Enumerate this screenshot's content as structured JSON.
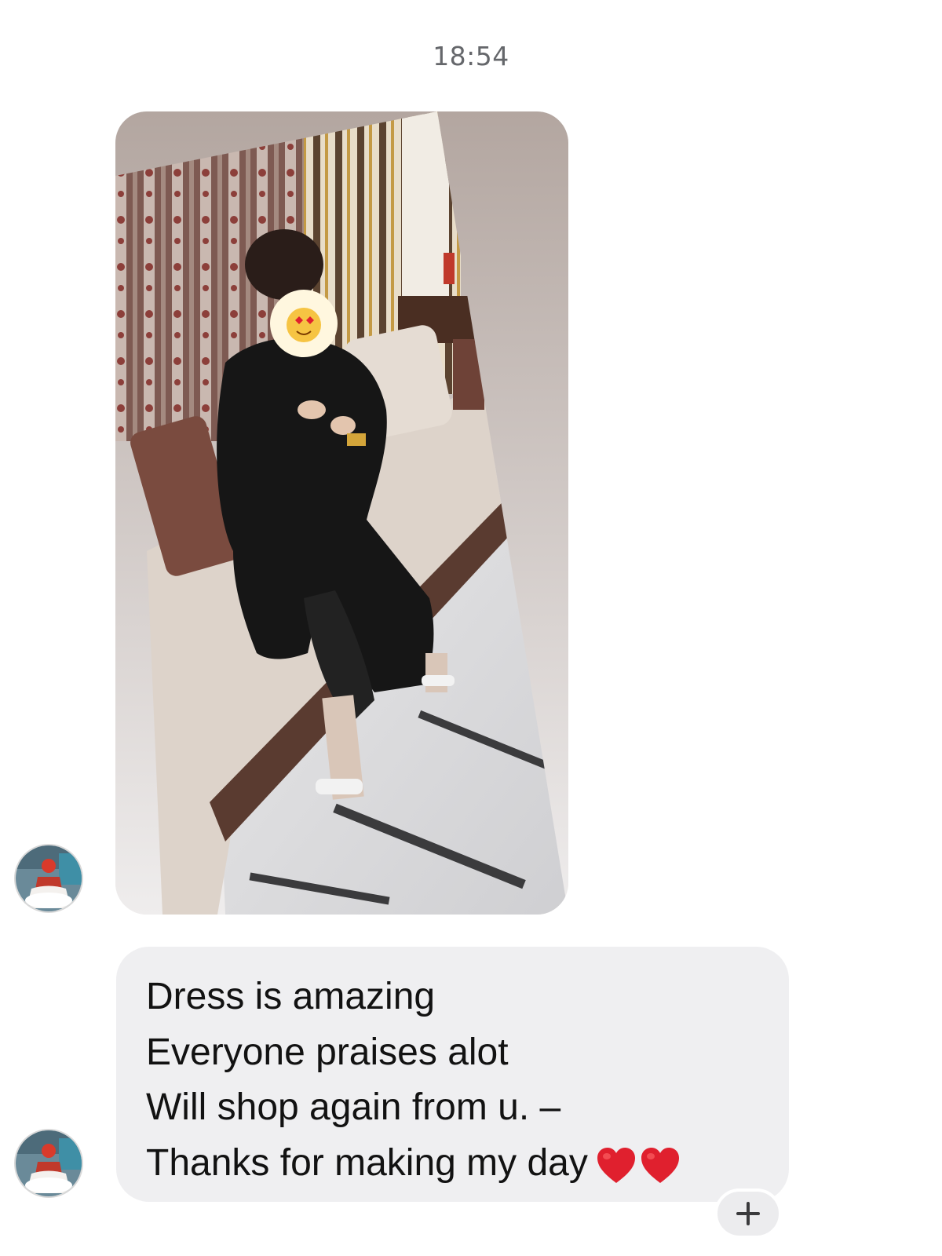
{
  "conversation": {
    "timestamp": "18:54"
  },
  "messages": [
    {
      "type": "photo",
      "sender": "contact",
      "image_alt_icon": "photo-icon"
    },
    {
      "type": "text",
      "sender": "contact",
      "lines": [
        "Dress is amazing",
        "Everyone praises alot",
        "Will shop again from u. –",
        "Thanks for making my day"
      ],
      "emoji": [
        "red-heart-icon",
        "red-heart-icon"
      ]
    }
  ],
  "react_button": {
    "icon": "plus-icon"
  },
  "colors": {
    "bubble": "#efeff1",
    "timestamp": "#65676b",
    "heart": "#e0202e",
    "text": "#121212"
  }
}
